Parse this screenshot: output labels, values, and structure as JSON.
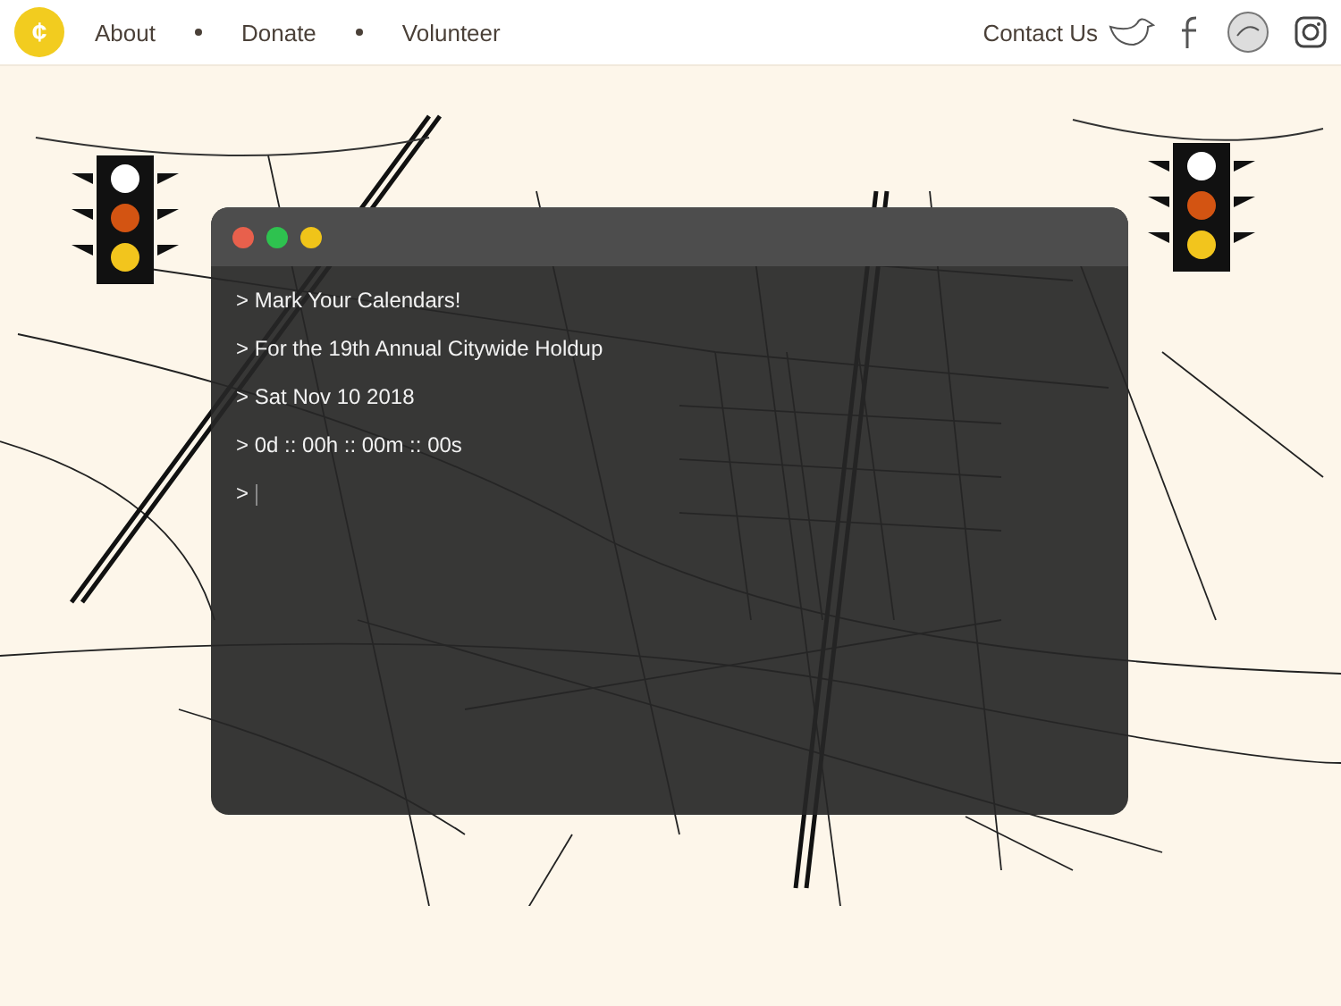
{
  "header": {
    "logo_symbol": "¢",
    "nav": [
      {
        "label": "About"
      },
      {
        "label": "Donate"
      },
      {
        "label": "Volunteer"
      }
    ],
    "contact": "Contact Us"
  },
  "terminal": {
    "lines": [
      "> Mark Your Calendars!",
      "> For the 19th Annual Citywide Holdup",
      "> Sat Nov 10 2018",
      "> 0d :: 00h :: 00m :: 00s"
    ],
    "prompt": ">"
  }
}
